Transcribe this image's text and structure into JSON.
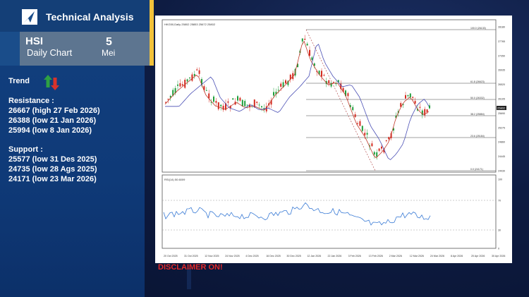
{
  "header": {
    "title": "Technical Analysis",
    "ticker": "HSI",
    "subtitle": "Daily Chart",
    "date_day": "5",
    "date_month": "Mei"
  },
  "trend": {
    "label": "Trend",
    "icon": "up-down-arrows-icon",
    "up_color": "#2ea043",
    "down_color": "#d9322b"
  },
  "resistance": {
    "heading": "Resistance :",
    "levels": [
      "26667 (high 27 Feb 2026)",
      "26388 (low 21 Jan 2026)",
      "25994 (low 8 Jan 2026)"
    ]
  },
  "support": {
    "heading": "Support :",
    "levels": [
      "25577 (low 31 Des 2025)",
      "24735 (low 28 Ags 2025)",
      "24171 (low 23 Mar 2026)"
    ]
  },
  "chart": {
    "header": "HKG50,Daily 25802 25853 25672 25802",
    "rsi_header": "RSI(14) 50.6009",
    "fib_labels": [
      "100.0 (26133)",
      "61.8 (26623)",
      "50.0 (26332)",
      "38.2 (25884)",
      "23.6 (25184)",
      "0.0 (24171)"
    ],
    "price_ticks": [
      "28180",
      "27765",
      "27350",
      "26935",
      "26520",
      "26105",
      "25690",
      "25275",
      "24860",
      "24445",
      "24030"
    ],
    "last_price": "25802",
    "rsi_ticks": [
      "100",
      "70",
      "30",
      "0"
    ],
    "date_ticks": [
      "20 Oct 2025",
      "31 Oct 2025",
      "12 Nov 2025",
      "24 Nov 2025",
      "4 Dec 2025",
      "16 Dec 2025",
      "30 Dec 2025",
      "12 Jan 2026",
      "22 Jan 2026",
      "3 Feb 2026",
      "13 Feb 2026",
      "2 Mar 2026",
      "12 Mar 2026",
      "24 Mar 2026",
      "8 Apr 2026",
      "20 Apr 2026",
      "30 Apr 2026"
    ],
    "colors": {
      "up": "#1e9e3a",
      "down": "#d42a1f",
      "ma_fast": "#c0392b",
      "ma_slow": "#4a4fb5",
      "rsi": "#3a7bd5"
    }
  },
  "disclaimer": "DISCLAIMER ON!"
}
